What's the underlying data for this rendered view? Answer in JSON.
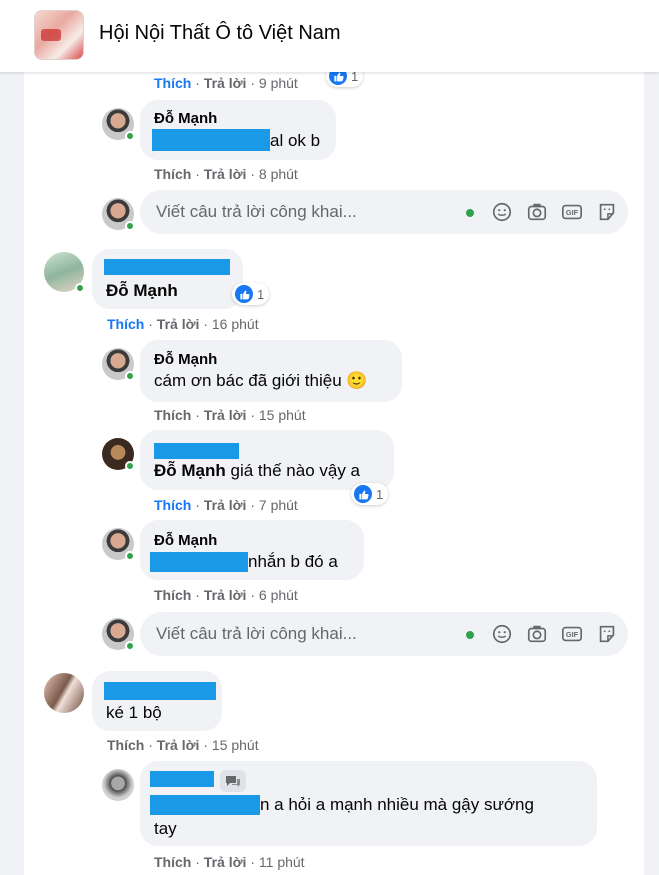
{
  "header": {
    "title": "Hội Nội Thất Ô tô Việt Nam"
  },
  "labels": {
    "like": "Thích",
    "reply": "Trả lời",
    "sep": "·"
  },
  "reply_placeholder": "Viết câu trả lời công khai...",
  "items": {
    "top_actions": {
      "time": "9 phút",
      "reactions": "1"
    },
    "c1": {
      "author": "Đỗ Mạnh",
      "text": "al ok b",
      "time": "8 phút"
    },
    "c2": {
      "author": "Đỗ Mạnh",
      "time": "16 phút",
      "reactions": "1"
    },
    "c3": {
      "author": "Đỗ Mạnh",
      "text": "cám ơn bác đã giới thiệu",
      "emoji": "🙂",
      "time": "15 phút"
    },
    "c4": {
      "mention": "Đỗ Mạnh",
      "text": "giá thế nào vậy a",
      "time": "7 phút",
      "reactions": "1"
    },
    "c5": {
      "author": "Đỗ Mạnh",
      "text": "nhắn b đó a",
      "time": "6 phút"
    },
    "c6": {
      "text": "ké 1 bộ",
      "time": "15 phút"
    },
    "c7": {
      "text_line1": "n a hỏi a mạnh nhiều mà gậy sướng",
      "text_line2": "tay",
      "time": "11 phút"
    }
  },
  "colors": {
    "accent": "#1877f2",
    "redaction": "#1a9ae6",
    "online": "#31a24c"
  }
}
